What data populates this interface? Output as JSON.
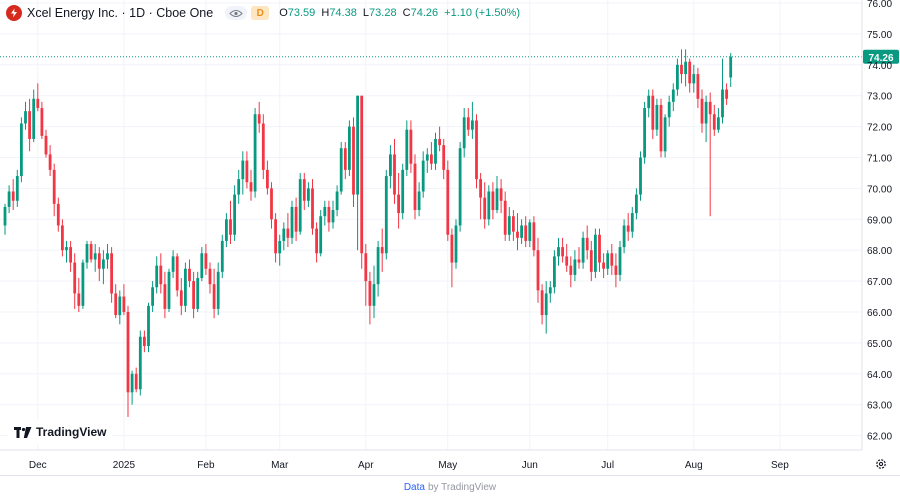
{
  "header": {
    "title": "Xcel Energy Inc. · 1D · Cboe One",
    "interval_badge": "D",
    "ohlc": [
      {
        "key": "O",
        "value": "73.59"
      },
      {
        "key": "H",
        "value": "74.38"
      },
      {
        "key": "L",
        "value": "73.28"
      },
      {
        "key": "C",
        "value": "74.26"
      },
      {
        "key": "",
        "value": "+1.10 (+1.50%)"
      }
    ]
  },
  "logo": {
    "text": "TradingView"
  },
  "footer": {
    "data_label": "Data",
    "by_label": "by TradingView"
  },
  "icons": {
    "symbol": "xcel-logo-icon",
    "visibility": "eye-icon",
    "settings": "gear-icon",
    "logo": "tradingview-logo-icon"
  },
  "colors": {
    "up": "#089981",
    "down": "#f23645",
    "last_price": "#089981",
    "grid": "#f0f3fa",
    "symbol_logo": "#d52a1d"
  },
  "chart_data": {
    "type": "candlestick",
    "title": "Xcel Energy Inc. · 1D · Cboe One",
    "last_price": 74.26,
    "last_price_label": "74.26",
    "ylim": [
      62,
      76
    ],
    "y_ticks": [
      62,
      63,
      64,
      65,
      66,
      67,
      68,
      69,
      70,
      71,
      72,
      73,
      74,
      75,
      76
    ],
    "y_tick_labels": [
      "62.00",
      "63.00",
      "64.00",
      "65.00",
      "66.00",
      "67.00",
      "68.00",
      "69.00",
      "70.00",
      "71.00",
      "72.00",
      "73.00",
      "74.00",
      "75.00",
      "76.00"
    ],
    "x_ticks": [
      {
        "label": "Dec",
        "index": 8
      },
      {
        "label": "2025",
        "index": 29
      },
      {
        "label": "Feb",
        "index": 49
      },
      {
        "label": "Mar",
        "index": 67
      },
      {
        "label": "Apr",
        "index": 88
      },
      {
        "label": "May",
        "index": 108
      },
      {
        "label": "Jun",
        "index": 128
      },
      {
        "label": "Jul",
        "index": 147
      },
      {
        "label": "Aug",
        "index": 168
      },
      {
        "label": "Sep",
        "index": 189
      }
    ],
    "candles": [
      [
        68.8,
        69.5,
        68.5,
        69.4
      ],
      [
        69.4,
        70.1,
        69.2,
        69.9
      ],
      [
        69.9,
        70.3,
        69.3,
        69.6
      ],
      [
        69.6,
        70.6,
        69.4,
        70.4
      ],
      [
        70.4,
        72.3,
        70.2,
        72.1
      ],
      [
        72.1,
        72.8,
        71.9,
        72.5
      ],
      [
        72.5,
        72.9,
        71.2,
        71.6
      ],
      [
        71.6,
        73.2,
        71.5,
        72.9
      ],
      [
        72.9,
        73.4,
        72.5,
        72.6
      ],
      [
        72.6,
        72.8,
        71.6,
        71.7
      ],
      [
        71.7,
        71.9,
        71.0,
        71.1
      ],
      [
        71.1,
        71.4,
        70.4,
        70.6
      ],
      [
        70.6,
        70.8,
        69.1,
        69.5
      ],
      [
        69.5,
        69.7,
        68.6,
        68.8
      ],
      [
        68.8,
        69.0,
        67.8,
        68.0
      ],
      [
        68.0,
        68.3,
        67.6,
        68.1
      ],
      [
        68.1,
        68.3,
        67.3,
        67.6
      ],
      [
        67.6,
        67.9,
        66.1,
        66.6
      ],
      [
        66.6,
        67.1,
        66.0,
        66.2
      ],
      [
        66.2,
        67.7,
        66.1,
        67.6
      ],
      [
        67.6,
        68.3,
        67.4,
        68.2
      ],
      [
        68.2,
        68.3,
        67.6,
        67.7
      ],
      [
        67.7,
        68.2,
        67.3,
        67.9
      ],
      [
        67.9,
        68.1,
        67.0,
        67.4
      ],
      [
        67.4,
        68.0,
        66.9,
        67.7
      ],
      [
        67.7,
        68.2,
        67.4,
        67.9
      ],
      [
        67.9,
        68.1,
        66.3,
        66.6
      ],
      [
        66.6,
        66.9,
        65.8,
        65.9
      ],
      [
        65.9,
        66.7,
        65.6,
        66.5
      ],
      [
        66.5,
        66.9,
        65.9,
        66.0
      ],
      [
        66.0,
        66.2,
        62.6,
        63.4
      ],
      [
        63.4,
        64.1,
        63.0,
        64.0
      ],
      [
        64.0,
        64.2,
        63.4,
        63.5
      ],
      [
        63.5,
        65.4,
        63.3,
        65.2
      ],
      [
        65.2,
        65.4,
        64.7,
        64.9
      ],
      [
        64.9,
        66.3,
        64.7,
        66.2
      ],
      [
        66.2,
        67.0,
        66.0,
        66.8
      ],
      [
        66.8,
        67.8,
        66.6,
        67.5
      ],
      [
        67.5,
        67.9,
        66.6,
        66.9
      ],
      [
        66.9,
        67.3,
        65.8,
        66.1
      ],
      [
        66.1,
        67.4,
        66.0,
        67.3
      ],
      [
        67.3,
        68.0,
        67.1,
        67.8
      ],
      [
        67.8,
        67.9,
        66.5,
        66.7
      ],
      [
        66.7,
        67.1,
        65.9,
        66.2
      ],
      [
        66.2,
        67.6,
        66.0,
        67.4
      ],
      [
        67.4,
        67.7,
        66.8,
        67.0
      ],
      [
        67.0,
        67.3,
        65.8,
        66.1
      ],
      [
        66.1,
        67.3,
        66.0,
        67.1
      ],
      [
        67.1,
        68.1,
        67.0,
        67.9
      ],
      [
        67.9,
        68.2,
        67.2,
        67.4
      ],
      [
        67.4,
        67.6,
        66.6,
        66.9
      ],
      [
        66.9,
        67.4,
        65.8,
        66.1
      ],
      [
        66.1,
        67.6,
        65.9,
        67.3
      ],
      [
        67.3,
        68.5,
        67.1,
        68.3
      ],
      [
        68.3,
        69.2,
        68.1,
        69.0
      ],
      [
        69.0,
        69.6,
        68.2,
        68.5
      ],
      [
        68.5,
        70.1,
        68.3,
        69.8
      ],
      [
        69.8,
        70.6,
        69.5,
        70.3
      ],
      [
        70.3,
        71.2,
        69.8,
        70.9
      ],
      [
        70.9,
        71.2,
        70.0,
        70.2
      ],
      [
        70.2,
        70.6,
        69.6,
        69.9
      ],
      [
        69.9,
        72.6,
        69.7,
        72.4
      ],
      [
        72.4,
        72.8,
        71.8,
        72.1
      ],
      [
        72.1,
        72.4,
        70.3,
        70.6
      ],
      [
        70.6,
        70.9,
        69.8,
        70.0
      ],
      [
        70.0,
        70.2,
        68.7,
        69.0
      ],
      [
        69.0,
        69.2,
        67.6,
        67.9
      ],
      [
        67.9,
        68.5,
        67.5,
        68.3
      ],
      [
        68.3,
        68.9,
        68.0,
        68.7
      ],
      [
        68.7,
        69.2,
        68.1,
        68.4
      ],
      [
        68.4,
        69.6,
        68.2,
        69.4
      ],
      [
        69.4,
        69.7,
        68.3,
        68.6
      ],
      [
        68.6,
        70.5,
        68.5,
        70.3
      ],
      [
        70.3,
        70.5,
        69.3,
        69.6
      ],
      [
        69.6,
        70.2,
        69.4,
        70.0
      ],
      [
        70.0,
        70.3,
        68.5,
        68.7
      ],
      [
        68.7,
        68.9,
        67.6,
        67.9
      ],
      [
        67.9,
        69.3,
        67.8,
        69.1
      ],
      [
        69.1,
        69.6,
        68.8,
        69.4
      ],
      [
        69.4,
        69.6,
        68.6,
        68.9
      ],
      [
        68.9,
        69.6,
        68.7,
        69.3
      ],
      [
        69.3,
        70.1,
        69.1,
        69.9
      ],
      [
        69.9,
        71.5,
        69.8,
        71.3
      ],
      [
        71.3,
        71.5,
        70.3,
        70.6
      ],
      [
        70.6,
        72.2,
        70.4,
        72.0
      ],
      [
        72.0,
        72.3,
        69.4,
        69.8
      ],
      [
        69.8,
        73.0,
        68.0,
        73.0
      ],
      [
        73.0,
        73.0,
        67.4,
        67.9
      ],
      [
        67.9,
        68.2,
        66.2,
        67.0
      ],
      [
        67.0,
        67.3,
        65.6,
        66.2
      ],
      [
        66.2,
        67.5,
        65.8,
        66.9
      ],
      [
        66.9,
        68.3,
        66.5,
        68.1
      ],
      [
        68.1,
        68.7,
        67.3,
        67.9
      ],
      [
        67.9,
        70.6,
        67.7,
        70.4
      ],
      [
        70.4,
        71.4,
        70.0,
        71.1
      ],
      [
        71.1,
        71.6,
        69.5,
        69.8
      ],
      [
        69.8,
        70.5,
        68.7,
        69.2
      ],
      [
        69.2,
        70.8,
        69.0,
        70.6
      ],
      [
        70.6,
        72.2,
        70.4,
        71.9
      ],
      [
        71.9,
        72.2,
        70.5,
        70.8
      ],
      [
        70.8,
        71.1,
        69.0,
        69.3
      ],
      [
        69.3,
        70.2,
        69.1,
        69.9
      ],
      [
        69.9,
        71.2,
        69.7,
        70.9
      ],
      [
        70.9,
        71.3,
        70.5,
        71.1
      ],
      [
        71.1,
        71.5,
        70.6,
        70.8
      ],
      [
        70.8,
        71.8,
        70.6,
        71.6
      ],
      [
        71.6,
        72.0,
        71.2,
        71.4
      ],
      [
        71.4,
        71.6,
        70.3,
        70.6
      ],
      [
        70.6,
        70.9,
        68.3,
        68.5
      ],
      [
        68.5,
        68.7,
        66.8,
        67.6
      ],
      [
        67.6,
        69.0,
        67.4,
        68.8
      ],
      [
        68.8,
        71.5,
        68.6,
        71.3
      ],
      [
        71.3,
        72.6,
        71.0,
        72.3
      ],
      [
        72.3,
        72.6,
        71.7,
        71.9
      ],
      [
        71.9,
        72.8,
        71.6,
        72.2
      ],
      [
        72.2,
        72.4,
        70.0,
        70.3
      ],
      [
        70.3,
        70.5,
        69.0,
        69.7
      ],
      [
        69.7,
        70.2,
        68.7,
        69.0
      ],
      [
        69.0,
        70.1,
        68.8,
        69.9
      ],
      [
        69.9,
        70.2,
        69.0,
        69.3
      ],
      [
        69.3,
        70.4,
        69.2,
        70.0
      ],
      [
        70.0,
        70.3,
        69.2,
        69.6
      ],
      [
        69.6,
        69.9,
        68.3,
        68.5
      ],
      [
        68.5,
        69.4,
        68.3,
        69.1
      ],
      [
        69.1,
        69.3,
        68.3,
        68.6
      ],
      [
        68.6,
        69.2,
        68.0,
        68.4
      ],
      [
        68.4,
        69.0,
        68.2,
        68.8
      ],
      [
        68.8,
        69.1,
        68.1,
        68.3
      ],
      [
        68.3,
        69.0,
        68.1,
        68.9
      ],
      [
        68.9,
        69.1,
        67.8,
        68.0
      ],
      [
        68.0,
        68.4,
        66.3,
        66.7
      ],
      [
        66.7,
        66.9,
        65.6,
        65.9
      ],
      [
        65.9,
        67.0,
        65.3,
        66.6
      ],
      [
        66.6,
        67.0,
        66.3,
        66.8
      ],
      [
        66.8,
        68.0,
        66.6,
        67.8
      ],
      [
        67.8,
        68.4,
        67.5,
        68.1
      ],
      [
        68.1,
        68.4,
        67.6,
        67.8
      ],
      [
        67.8,
        68.2,
        67.3,
        67.5
      ],
      [
        67.5,
        67.8,
        66.8,
        67.2
      ],
      [
        67.2,
        68.0,
        67.0,
        67.7
      ],
      [
        67.7,
        68.1,
        67.4,
        67.6
      ],
      [
        67.6,
        68.6,
        67.4,
        68.4
      ],
      [
        68.4,
        68.8,
        67.7,
        68.0
      ],
      [
        68.0,
        68.3,
        67.0,
        67.3
      ],
      [
        67.3,
        68.7,
        67.1,
        68.5
      ],
      [
        68.5,
        68.7,
        67.3,
        67.6
      ],
      [
        67.6,
        67.9,
        67.1,
        67.4
      ],
      [
        67.4,
        68.0,
        67.2,
        67.9
      ],
      [
        67.9,
        68.2,
        67.2,
        67.5
      ],
      [
        67.5,
        67.9,
        66.8,
        67.2
      ],
      [
        67.2,
        68.3,
        67.0,
        68.1
      ],
      [
        68.1,
        69.0,
        67.9,
        68.8
      ],
      [
        68.8,
        69.2,
        68.3,
        68.6
      ],
      [
        68.6,
        69.4,
        68.4,
        69.2
      ],
      [
        69.2,
        70.0,
        69.0,
        69.8
      ],
      [
        69.8,
        71.2,
        69.6,
        71.0
      ],
      [
        71.0,
        72.8,
        70.8,
        72.6
      ],
      [
        72.6,
        73.2,
        72.3,
        73.0
      ],
      [
        73.0,
        73.2,
        71.6,
        71.9
      ],
      [
        71.9,
        72.9,
        71.7,
        72.7
      ],
      [
        72.7,
        72.9,
        71.0,
        71.2
      ],
      [
        71.2,
        72.4,
        71.0,
        72.3
      ],
      [
        72.3,
        73.0,
        72.0,
        72.8
      ],
      [
        72.8,
        73.4,
        72.5,
        73.2
      ],
      [
        73.2,
        74.2,
        73.0,
        74.0
      ],
      [
        74.0,
        74.5,
        73.4,
        73.7
      ],
      [
        73.7,
        74.5,
        73.3,
        74.1
      ],
      [
        74.1,
        74.2,
        73.1,
        73.4
      ],
      [
        73.4,
        74.0,
        73.1,
        73.7
      ],
      [
        73.7,
        73.9,
        72.6,
        72.9
      ],
      [
        72.9,
        73.2,
        71.8,
        72.1
      ],
      [
        72.1,
        73.0,
        71.5,
        72.8
      ],
      [
        72.8,
        73.1,
        69.1,
        72.4
      ],
      [
        72.4,
        72.7,
        71.7,
        71.9
      ],
      [
        71.9,
        72.6,
        71.8,
        72.3
      ],
      [
        72.3,
        74.2,
        72.1,
        73.2
      ],
      [
        73.2,
        73.4,
        72.7,
        72.9
      ],
      [
        73.59,
        74.38,
        73.28,
        74.26
      ]
    ]
  }
}
